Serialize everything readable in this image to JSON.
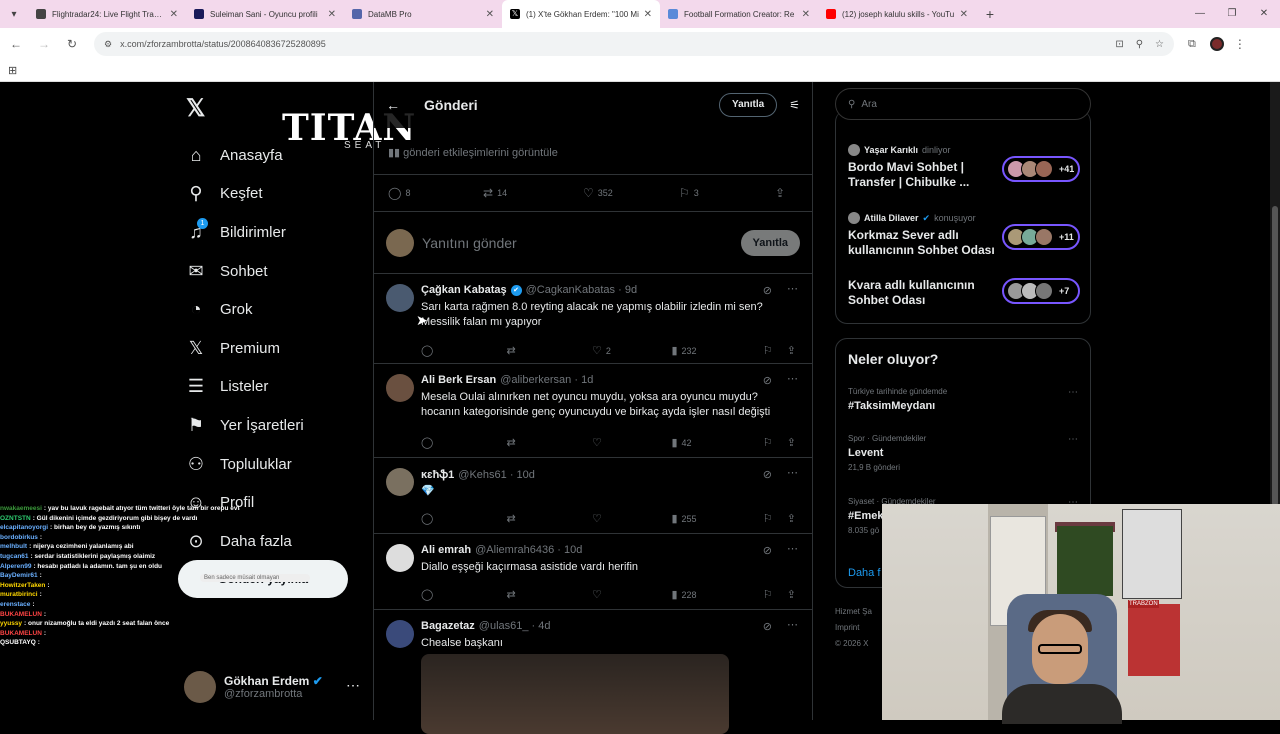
{
  "browser": {
    "tabs": [
      {
        "title": "Flightradar24: Live Flight Tracke",
        "color": "#444444"
      },
      {
        "title": "Suleiman Sani - Oyuncu profili",
        "color": "#1a1a5a"
      },
      {
        "title": "DataMB Pro",
        "color": "#5566aa"
      },
      {
        "title": "(1) X'te Gökhan Erdem: \"100 Mi",
        "color": "#000000"
      },
      {
        "title": "Football Formation Creator: Re",
        "color": "#5a8ad9"
      },
      {
        "title": "(12) joseph kalulu skills - YouTu",
        "color": "#ff0000"
      }
    ],
    "url": "x.com/zforzambrotta/status/2008640836725280895"
  },
  "sidebar": {
    "titan_logo": "TITAN",
    "titan_sub": "SEAT",
    "items": [
      {
        "label": "Anasayfa",
        "icon": "home-icon",
        "glyph": "⌂"
      },
      {
        "label": "Keşfet",
        "icon": "search-icon",
        "glyph": "⚲"
      },
      {
        "label": "Bildirimler",
        "icon": "bell-icon",
        "glyph": "🔔",
        "badge": "1"
      },
      {
        "label": "Sohbet",
        "icon": "mail-icon",
        "glyph": "✉"
      },
      {
        "label": "Grok",
        "icon": "grok-icon",
        "glyph": "◔"
      },
      {
        "label": "Premium",
        "icon": "x-premium-icon",
        "glyph": "𝕏"
      },
      {
        "label": "Listeler",
        "icon": "list-icon",
        "glyph": "☰"
      },
      {
        "label": "Yer İşaretleri",
        "icon": "bookmark-icon",
        "glyph": "⚑"
      },
      {
        "label": "Topluluklar",
        "icon": "communities-icon",
        "glyph": "👥"
      },
      {
        "label": "Profil",
        "icon": "profile-icon",
        "glyph": "👤"
      },
      {
        "label": "Daha fazla",
        "icon": "more-circle-icon",
        "glyph": "⋯"
      }
    ],
    "post_button": "Gönderi yayınla",
    "account": {
      "name": "Gökhan Erdem",
      "handle": "@zforzambrotta"
    }
  },
  "main": {
    "header_title": "Gönderi",
    "header_reply": "Yanıtla",
    "engagements_link": "gönderi etkileşimlerini görüntüle",
    "stats": {
      "replies": "8",
      "reposts": "14",
      "likes": "352",
      "bookmarks": "3"
    },
    "reply_placeholder": "Yanıtını gönder",
    "reply_button": "Yanıtla",
    "tweets": [
      {
        "name": "Çağkan Kabataş",
        "verified": true,
        "handle": "@CagkanKabatas",
        "date": "9d",
        "text": "Sarı karta rağmen 8.0 reyting alacak ne yapmış olabilir izledin mi sen? Messilik falan mı yapıyor",
        "replies": "",
        "reposts": "",
        "likes": "2",
        "views": "232"
      },
      {
        "name": "Ali Berk Ersan",
        "verified": false,
        "handle": "@aliberkersan",
        "date": "1d",
        "text": "Mesela Oulai alınırken net oyuncu muydu, yoksa ara oyuncu muydu? hocanın kategorisinde genç oyuncuydu ve birkaç ayda işler nasıl değişti",
        "replies": "",
        "reposts": "",
        "likes": "",
        "views": "42"
      },
      {
        "name": "ĸɛħֆ1",
        "verified": false,
        "handle": "@Kehs61",
        "date": "10d",
        "text": "💎",
        "replies": "",
        "reposts": "",
        "likes": "",
        "views": "255"
      },
      {
        "name": "Ali emrah",
        "verified": false,
        "handle": "@Aliemrah6436",
        "date": "10d",
        "text": "Diallo eşşeği kaçırmasa asistide vardı herifin",
        "replies": "",
        "reposts": "",
        "likes": "",
        "views": "228"
      },
      {
        "name": "Bagazetaz",
        "verified": false,
        "handle": "@ulas61_",
        "date": "4d",
        "text": "Chealse başkanı",
        "replies": "",
        "reposts": "",
        "likes": "",
        "views": ""
      }
    ]
  },
  "right": {
    "search_placeholder": "Ara",
    "spaces": [
      {
        "host": "Yaşar Karıklı",
        "role": "dinliyor",
        "title": "Bordo Mavi Sohbet | Transfer |  Chibulke ...",
        "count": "+41"
      },
      {
        "host": "Atilla Dilaver",
        "role": "konuşuyor",
        "title": "Korkmaz Sever adlı kullanıcının Sohbet Odası",
        "count": "+11"
      },
      {
        "host": "",
        "role": "",
        "title": "Kvara adlı kullanıcının Sohbet Odası",
        "count": "+7"
      }
    ],
    "trends_title": "Neler oluyor?",
    "trends": [
      {
        "context": "Türkiye tarihinde gündemde",
        "name": "#TaksimMeydanı",
        "count": ""
      },
      {
        "context": "Spor · Gündemdekiler",
        "name": "Levent",
        "count": "21,9 B gönderi"
      },
      {
        "context": "Siyaset · Gündemdekiler",
        "name": "#Emek",
        "count": "8.035 gö"
      }
    ],
    "show_more": "Daha f",
    "footer": [
      "Hizmet Şa",
      "Imprint",
      "© 2026 X"
    ]
  },
  "stream": {
    "jersey_label": "TRABZON",
    "chat": [
      {
        "user": "nwakaemeesi",
        "ucolor": "#3b9a3b",
        "msg": ": yav bu lavuk ragebait atıyor tüm twitteri öyle tam bir orepu evladı"
      },
      {
        "user": "OZNTSTN",
        "ucolor": "#2ecc71",
        "msg": ": Gül dikenini içimde gezdiriyorum gibi bişey de vardı"
      },
      {
        "user": "elcapitanoyorgi",
        "ucolor": "#6ab0ff",
        "msg": ": birhan bey de yazmış sıkıntı"
      },
      {
        "user": "bordobirkus",
        "ucolor": "#6ab0ff",
        "msg": ":"
      },
      {
        "user": "melhbult",
        "ucolor": "#6ab0ff",
        "msg": ": nijerya cezimheni yalanlamış abi"
      },
      {
        "user": "tugcan61",
        "ucolor": "#6ab0ff",
        "msg": ": serdar istatistiklerini paylaşmış olaimiz"
      },
      {
        "user": "Alperen99",
        "ucolor": "#6ab0ff",
        "msg": ": hesabı patladı la adamın. tam şu en oldu"
      },
      {
        "user": "BayDemir61",
        "ucolor": "#6ab0ff",
        "msg": ":"
      },
      {
        "user": "HowitzerTaken",
        "ucolor": "#ffd700",
        "msg": ":"
      },
      {
        "user": "muratbirinci",
        "ucolor": "#ffd700",
        "msg": ":"
      },
      {
        "user": "erenstace",
        "ucolor": "#6ab0ff",
        "msg": ":"
      },
      {
        "user": "BUKAMELUN",
        "ucolor": "#ff4444",
        "msg": ":"
      },
      {
        "user": "yyussy",
        "ucolor": "#ffd700",
        "msg": ": onur nizamoğlu ta eldi yazdı 2 seat falan önce"
      },
      {
        "user": "BUKAMELUN",
        "ucolor": "#ff4444",
        "msg": ":"
      },
      {
        "user": "QSUBTAYQ",
        "ucolor": "#ffffff",
        "msg": ":"
      }
    ],
    "popup_text": "Ben sadece müsait olmayan"
  }
}
